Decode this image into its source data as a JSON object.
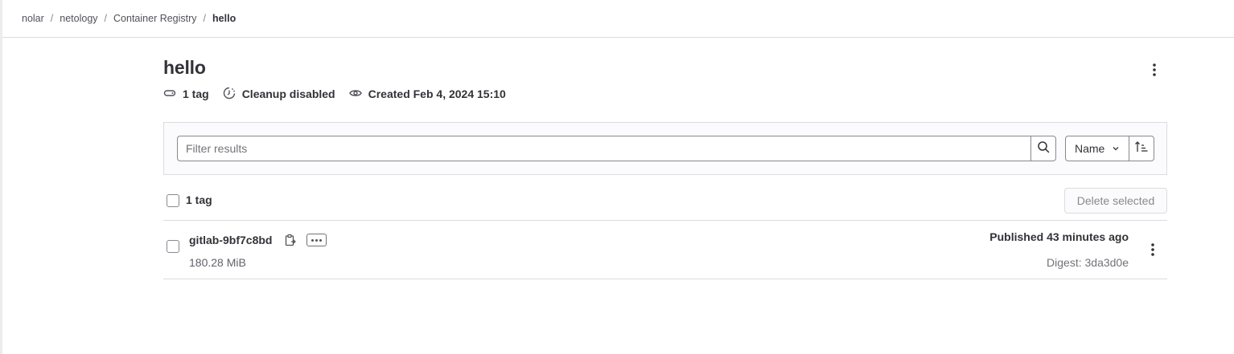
{
  "breadcrumb": {
    "items": [
      "nolar",
      "netology",
      "Container Registry"
    ],
    "current": "hello",
    "separator": "/"
  },
  "image": {
    "title": "hello",
    "meta": {
      "tags": "1 tag",
      "cleanup": "Cleanup disabled",
      "created": "Created Feb 4, 2024 15:10"
    }
  },
  "filter": {
    "placeholder": "Filter results",
    "sort_label": "Name"
  },
  "list": {
    "count_label": "1 tag",
    "delete_label": "Delete selected",
    "rows": [
      {
        "name": "gitlab-9bf7c8bd",
        "size": "180.28 MiB",
        "published": "Published 43 minutes ago",
        "digest": "Digest: 3da3d0e"
      }
    ]
  },
  "icons": {
    "tag": "label-icon",
    "cleanup": "expire-icon",
    "created": "eye-icon",
    "search": "search-icon",
    "sort_direction": "sort-lowest-icon",
    "copy": "copy-to-clipboard-icon",
    "actions": "ellipsis-icon",
    "kebab": "kebab-vertical-icon"
  },
  "colors": {
    "text": "#333238",
    "muted": "#737278",
    "border": "#dcdcde",
    "filter_bg": "#fbfafd"
  }
}
